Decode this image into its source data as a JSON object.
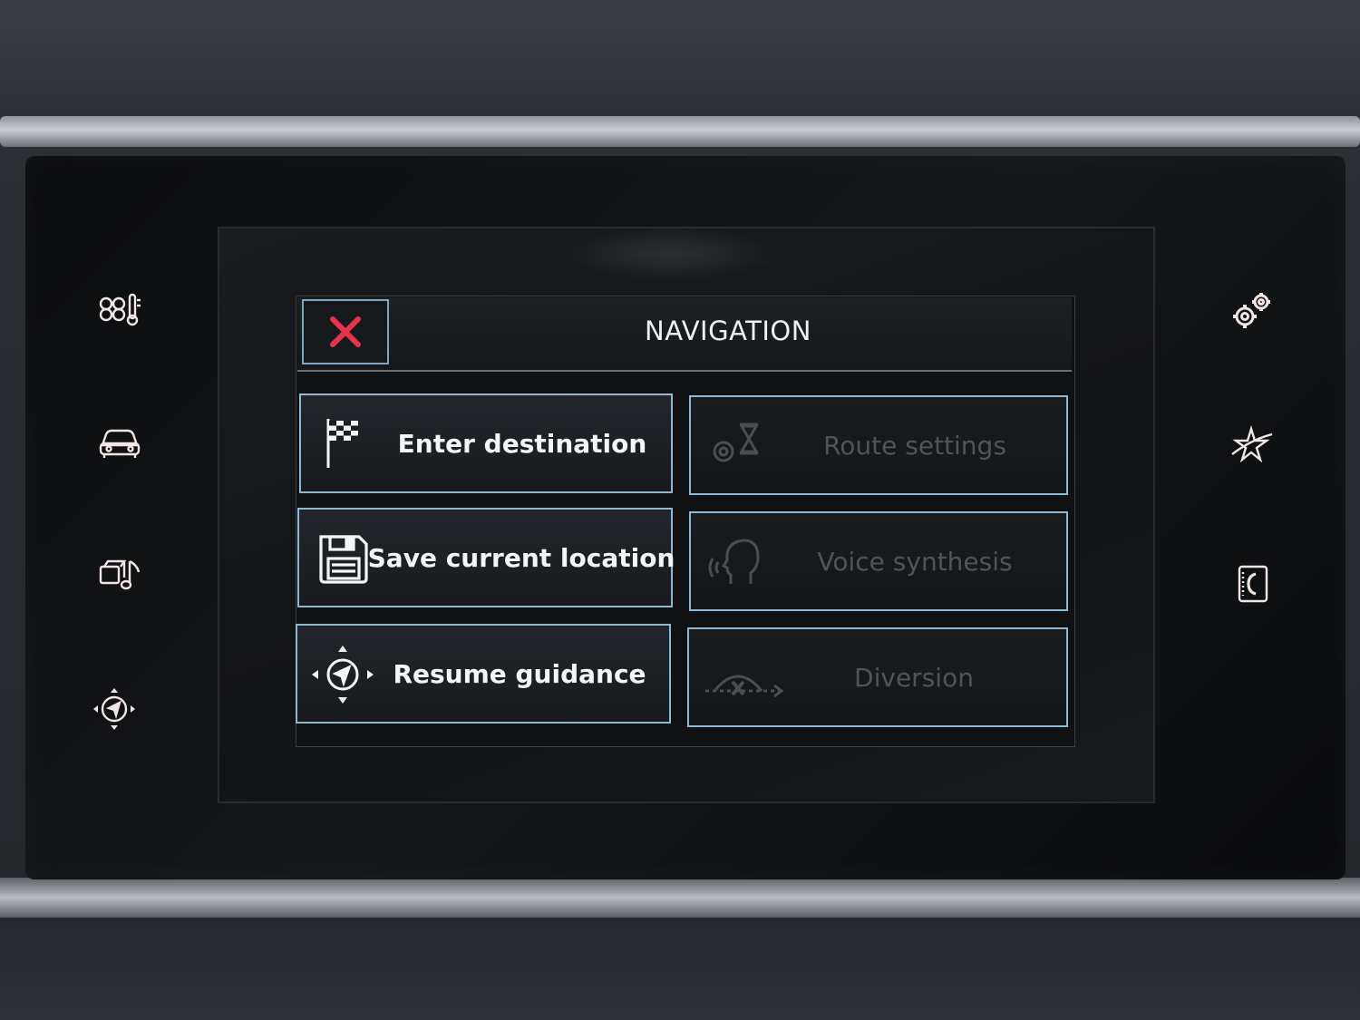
{
  "header": {
    "title": "NAVIGATION",
    "close_icon": "close-icon"
  },
  "menu": {
    "items": [
      {
        "label": "Enter destination",
        "icon": "checkered-flag-icon",
        "enabled": true
      },
      {
        "label": "Route settings",
        "icon": "route-settings-icon",
        "enabled": false
      },
      {
        "label": "Save current location",
        "icon": "floppy-disk-icon",
        "enabled": true
      },
      {
        "label": "Voice synthesis",
        "icon": "voice-head-icon",
        "enabled": false
      },
      {
        "label": "Resume guidance",
        "icon": "compass-navigation-icon",
        "enabled": true
      },
      {
        "label": "Diversion",
        "icon": "diversion-icon",
        "enabled": false
      }
    ]
  },
  "side_buttons": {
    "left": [
      "climate-icon",
      "vehicle-icon",
      "media-icon",
      "navigation-icon"
    ],
    "right": [
      "settings-icon",
      "connected-services-icon",
      "phone-icon"
    ]
  },
  "colors": {
    "accent_border": "#8fb8d2",
    "close_x": "#e8344a",
    "text_enabled": "#f4f5f6",
    "text_disabled": "#50545a",
    "side_icon": "#f2e6e4"
  }
}
